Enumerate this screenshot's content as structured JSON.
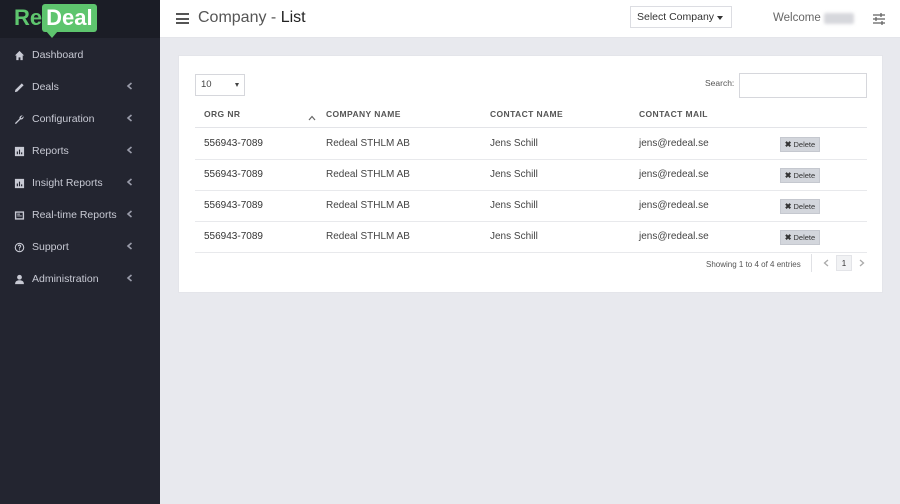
{
  "brand": {
    "part1": "Re",
    "part2": "Deal",
    "color": "#5ec56e"
  },
  "sidebar": {
    "items": [
      {
        "label": "Dashboard",
        "icon": "home-icon",
        "has_chevron": false
      },
      {
        "label": "Deals",
        "icon": "pencil-icon",
        "has_chevron": true
      },
      {
        "label": "Configuration",
        "icon": "wrench-icon",
        "has_chevron": true
      },
      {
        "label": "Reports",
        "icon": "chart-icon",
        "has_chevron": true
      },
      {
        "label": "Insight Reports",
        "icon": "chart-icon",
        "has_chevron": true
      },
      {
        "label": "Real-time Reports",
        "icon": "monitor-icon",
        "has_chevron": true
      },
      {
        "label": "Support",
        "icon": "question-circle-icon",
        "has_chevron": true
      },
      {
        "label": "Administration",
        "icon": "user-icon",
        "has_chevron": true
      }
    ]
  },
  "header": {
    "title_prefix": "Company - ",
    "title_main": "List",
    "select_company": "Select Company",
    "welcome": "Welcome"
  },
  "table_controls": {
    "page_length": "10",
    "search_label": "Search:",
    "search_value": ""
  },
  "table": {
    "columns": [
      "ORG NR",
      "COMPANY NAME",
      "CONTACT NAME",
      "CONTACT MAIL"
    ],
    "rows": [
      {
        "org_nr": "556943-7089",
        "company": "Redeal STHLM AB",
        "contact": "Jens Schill",
        "mail": "jens@redeal.se",
        "action": "Delete"
      },
      {
        "org_nr": "556943-7089",
        "company": "Redeal STHLM AB",
        "contact": "Jens Schill",
        "mail": "jens@redeal.se",
        "action": "Delete"
      },
      {
        "org_nr": "556943-7089",
        "company": "Redeal STHLM AB",
        "contact": "Jens Schill",
        "mail": "jens@redeal.se",
        "action": "Delete"
      },
      {
        "org_nr": "556943-7089",
        "company": "Redeal STHLM AB",
        "contact": "Jens Schill",
        "mail": "jens@redeal.se",
        "action": "Delete"
      }
    ]
  },
  "footer": {
    "info": "Showing 1 to 4 of 4 entries",
    "page": "1"
  }
}
